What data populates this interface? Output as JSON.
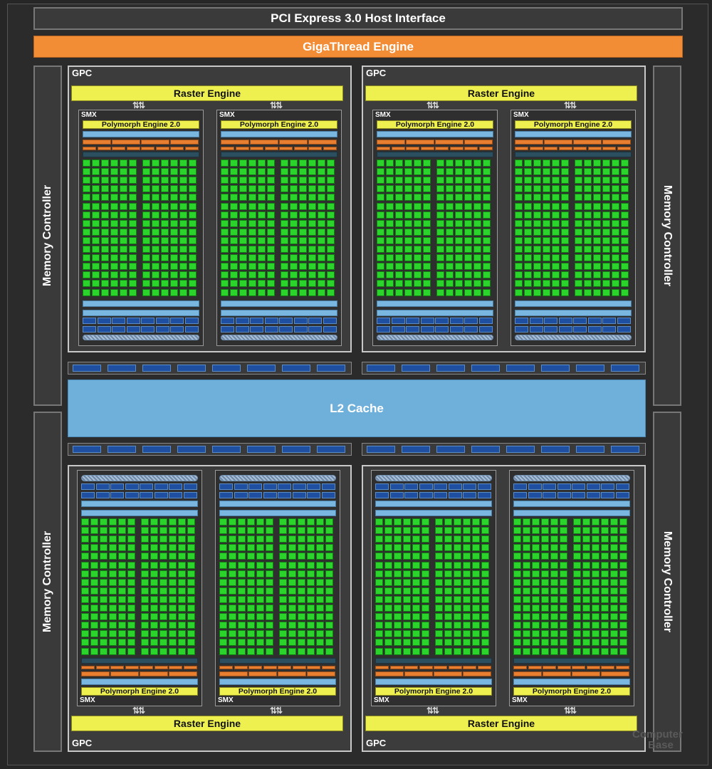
{
  "header": {
    "host_interface": "PCI Express 3.0 Host Interface",
    "gigathread": "GigaThread Engine"
  },
  "memory_controller_label": "Memory Controller",
  "l2_cache": "L2 Cache",
  "gpc": {
    "label": "GPC",
    "raster_engine": "Raster Engine",
    "smx_label": "SMX",
    "polymorph_engine": "Polymorph Engine 2.0"
  },
  "watermark": {
    "line1": "Computer",
    "line2": "Base"
  },
  "colors": {
    "host_bar": "#3a3a3a",
    "gigathread": "#f28c35",
    "raster": "#eef050",
    "core": "#2bd42b",
    "ld_st": "#1f4fa0",
    "l2": "#6fb0db",
    "dispatch": "#e77e30"
  },
  "counts": {
    "gpcs": 4,
    "smx_per_gpc": 2,
    "memory_controllers": 4
  }
}
